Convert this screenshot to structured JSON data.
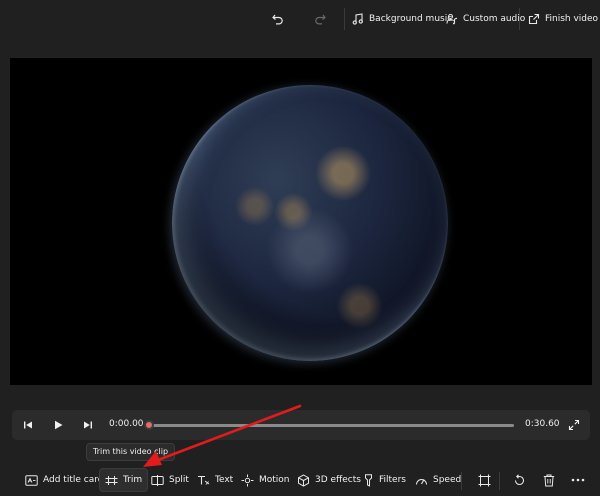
{
  "toolbar": {
    "background_music": "Background music",
    "custom_audio": "Custom audio",
    "finish_video": "Finish video"
  },
  "playback": {
    "current_time": "0:00.00",
    "total_time": "0:30.60",
    "progress": 0
  },
  "tooltip": {
    "text": "Trim this video clip"
  },
  "bottom_toolbar": {
    "add_title_card": "Add title card",
    "trim": "Trim",
    "split": "Split",
    "text": "Text",
    "motion": "Motion",
    "effects_3d": "3D effects",
    "filters": "Filters",
    "speed": "Speed"
  },
  "colors": {
    "background": "#202020",
    "panel": "#2b2b2b",
    "scrub_thumb": "#e06b6b",
    "annotation_arrow": "#e21c1c"
  },
  "icons": {
    "undo": "undo-icon",
    "redo": "redo-icon",
    "music": "music-note-icon",
    "audio": "custom-audio-icon",
    "finish": "share-export-icon",
    "skip_back": "skip-back-icon",
    "play": "play-icon",
    "skip_forward": "skip-forward-icon",
    "fullscreen": "expand-icon",
    "crop": "crop-icon",
    "rotate": "rotate-icon",
    "delete": "trash-icon",
    "more": "more-icon"
  }
}
